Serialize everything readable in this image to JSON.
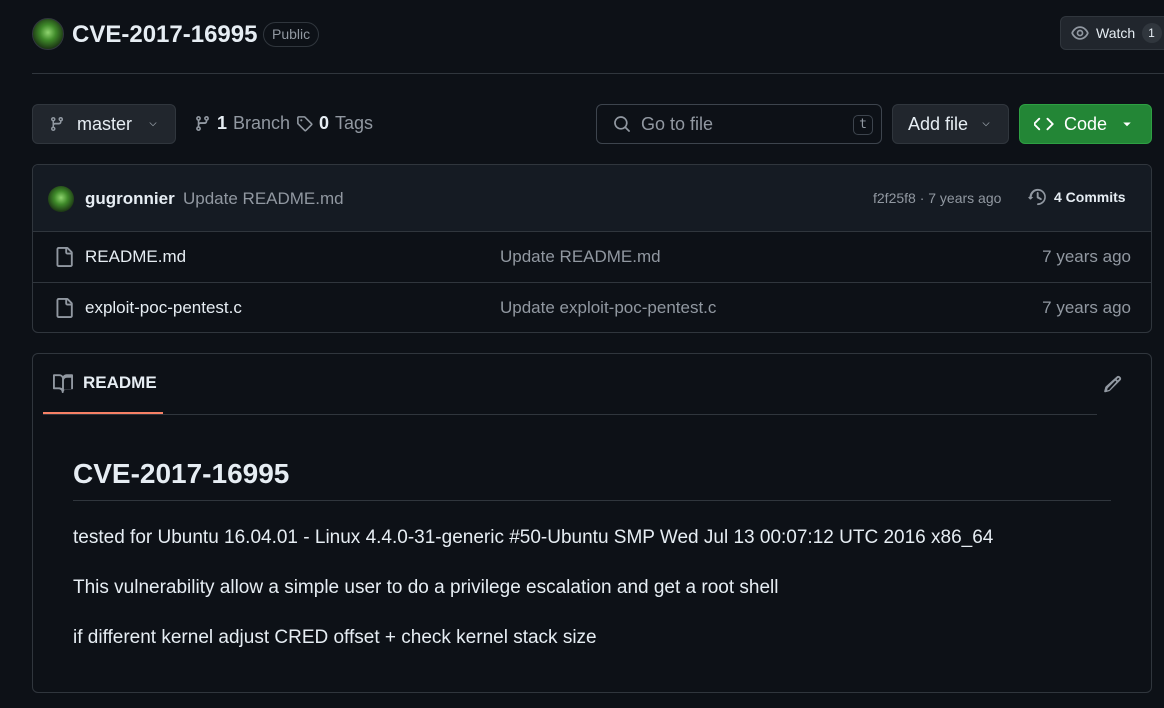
{
  "repo": {
    "name": "CVE-2017-16995",
    "visibility": "Public",
    "watch_label": "Watch",
    "watch_count": "1"
  },
  "toolbar": {
    "branch": "master",
    "branch_count": "1",
    "branch_label": "Branch",
    "tag_count": "0",
    "tag_label": "Tags",
    "goto_placeholder": "Go to file",
    "goto_shortcut": "t",
    "add_file_label": "Add file",
    "code_label": "Code"
  },
  "latest_commit": {
    "author": "gugronnier",
    "message": "Update README.md",
    "meta": "f2f25f8 · 7 years ago",
    "commits_label": "4 Commits"
  },
  "files": [
    {
      "name": "README.md",
      "message": "Update README.md",
      "age": "7 years ago"
    },
    {
      "name": "exploit-poc-pentest.c",
      "message": "Update exploit-poc-pentest.c",
      "age": "7 years ago"
    }
  ],
  "readme": {
    "tab_label": "README",
    "heading": "CVE-2017-16995",
    "paragraphs": [
      "tested for Ubuntu 16.04.01 - Linux 4.4.0-31-generic #50-Ubuntu SMP Wed Jul 13 00:07:12 UTC 2016 x86_64",
      "This vulnerability allow a simple user to do a privilege escalation and get a root shell",
      "if different kernel adjust CRED offset + check kernel stack size"
    ]
  },
  "colors": {
    "background": "#0d1117",
    "border": "#30363d",
    "code_button": "#238636",
    "readme_tab_underline": "#f78166"
  }
}
